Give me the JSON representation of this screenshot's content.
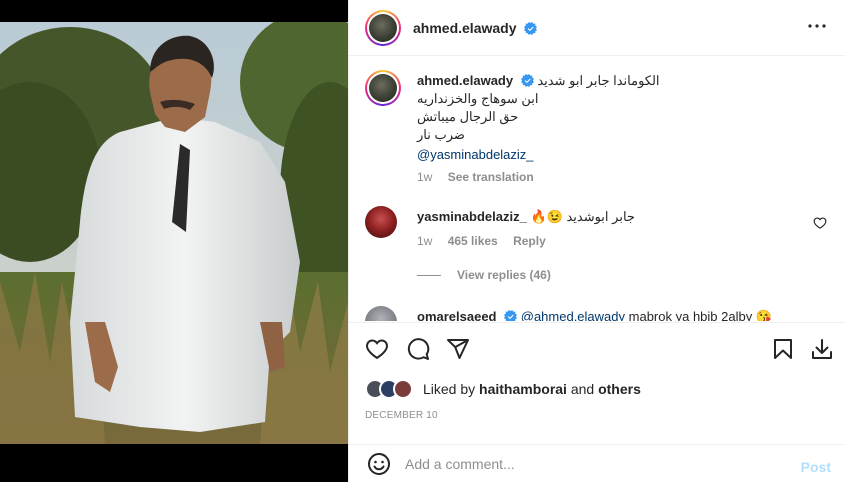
{
  "post": {
    "username": "ahmed.elawady",
    "caption": {
      "lines": [
        "الكوماندا جابر ابو شديد",
        "ابن سوهاج والخزنداريه",
        "حق الرجال ميباتش",
        "ضرب نار"
      ],
      "mention": "@yasminabdelaziz_",
      "age": "1w",
      "see_translation": "See translation"
    },
    "comments": [
      {
        "username": "yasminabdelaziz_",
        "text": "جابر ابوشديد 😉🔥",
        "age": "1w",
        "likes": "465 likes",
        "reply": "Reply",
        "view_replies": "View replies (46)"
      },
      {
        "username": "omarelsaeed",
        "mention": "@ahmed.elawady",
        "text": "mabrok ya hbib 2alby 😘"
      }
    ],
    "liked_by": {
      "prefix": "Liked by",
      "user": "haithamborai",
      "and": "and",
      "others": "others"
    },
    "date": "DECEMBER 10",
    "add_comment": {
      "placeholder": "Add a comment...",
      "post_label": "Post"
    }
  },
  "colors": {
    "verified": "#3897f0",
    "link": "#00376b",
    "muted": "#8e8e8e",
    "post_disabled": "#b2dffc"
  },
  "icons": [
    "more-options-icon",
    "verified-badge-icon",
    "heart-icon",
    "comment-icon",
    "share-icon",
    "bookmark-icon",
    "download-icon",
    "emoji-icon",
    "comment-heart-icon"
  ]
}
